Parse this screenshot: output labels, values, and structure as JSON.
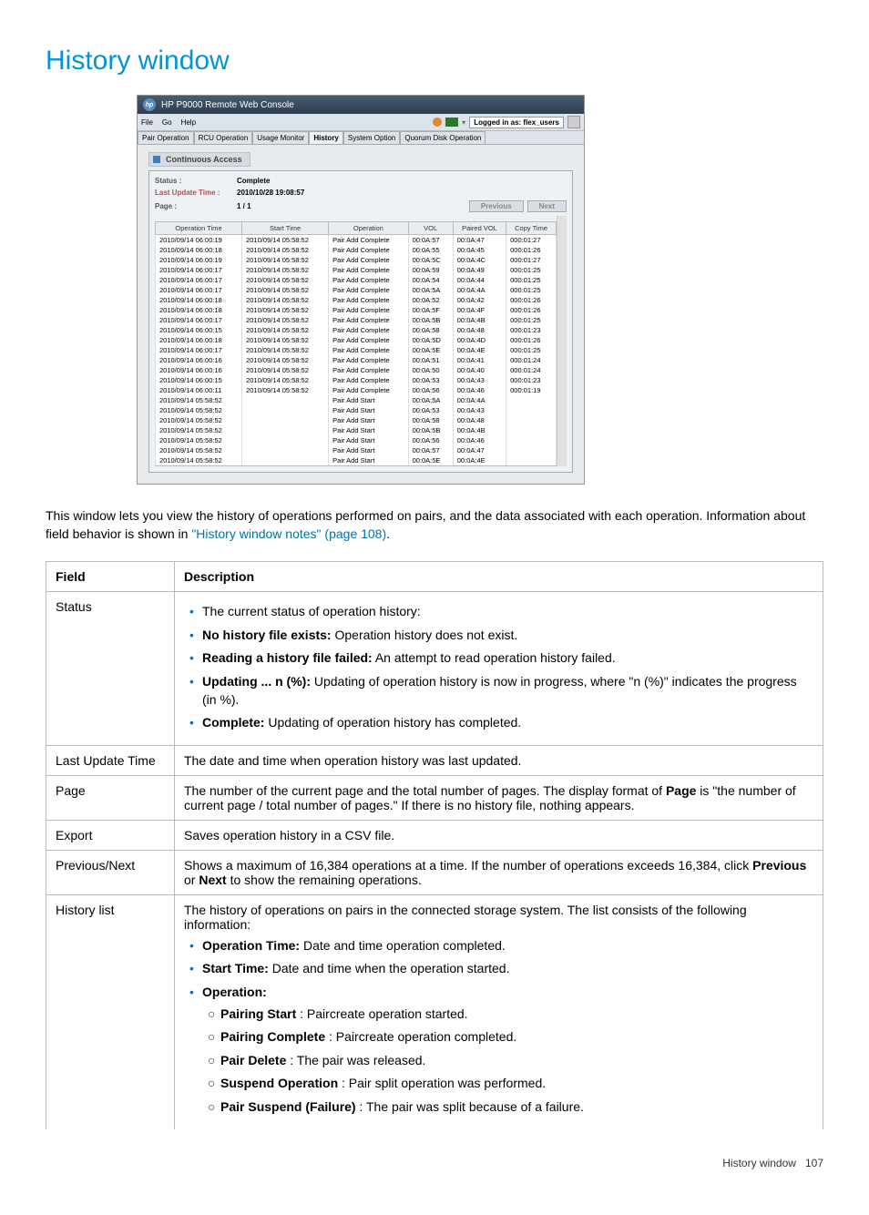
{
  "page_title": "History window",
  "footer": {
    "text": "History window",
    "page": "107"
  },
  "app": {
    "title": "HP P9000 Remote Web Console",
    "menus": [
      "File",
      "Go",
      "Help"
    ],
    "login_label": "Logged in as: flex_users",
    "tabs": [
      "Pair Operation",
      "RCU Operation",
      "Usage Monitor",
      "History",
      "System Option",
      "Quorum Disk Operation"
    ],
    "section": "Continuous Access",
    "status_label": "Status :",
    "status_value": "Complete",
    "update_label": "Last Update Time :",
    "update_value": "2010/10/28 19:08:57",
    "page_label": "Page :",
    "page_value": "1 / 1",
    "prev_btn": "Previous",
    "next_btn": "Next",
    "columns": [
      "Operation Time",
      "Start Time",
      "Operation",
      "VOL",
      "Paired VOL",
      "Copy Time"
    ],
    "rows": [
      [
        "2010/09/14 06:00:19",
        "2010/09/14 05:58:52",
        "Pair Add Complete",
        "00:0A:57",
        "00:0A:47",
        "000:01:27"
      ],
      [
        "2010/09/14 06:00:18",
        "2010/09/14 05:58:52",
        "Pair Add Complete",
        "00:0A:55",
        "00:0A:45",
        "000:01:26"
      ],
      [
        "2010/09/14 06:00:19",
        "2010/09/14 05:58:52",
        "Pair Add Complete",
        "00:0A:5C",
        "00:0A:4C",
        "000:01:27"
      ],
      [
        "2010/09/14 06:00:17",
        "2010/09/14 05:58:52",
        "Pair Add Complete",
        "00:0A:59",
        "00:0A:49",
        "000:01:25"
      ],
      [
        "2010/09/14 06:00:17",
        "2010/09/14 05:58:52",
        "Pair Add Complete",
        "00:0A:54",
        "00:0A:44",
        "000:01:25"
      ],
      [
        "2010/09/14 06:00:17",
        "2010/09/14 05:58:52",
        "Pair Add Complete",
        "00:0A:5A",
        "00:0A:4A",
        "000:01:25"
      ],
      [
        "2010/09/14 06:00:18",
        "2010/09/14 05:58:52",
        "Pair Add Complete",
        "00:0A:52",
        "00:0A:42",
        "000:01:26"
      ],
      [
        "2010/09/14 06:00:18",
        "2010/09/14 05:58:52",
        "Pair Add Complete",
        "00:0A:5F",
        "00:0A:4F",
        "000:01:26"
      ],
      [
        "2010/09/14 06:00:17",
        "2010/09/14 05:58:52",
        "Pair Add Complete",
        "00:0A:5B",
        "00:0A:4B",
        "000:01:25"
      ],
      [
        "2010/09/14 06:00:15",
        "2010/09/14 05:58:52",
        "Pair Add Complete",
        "00:0A:58",
        "00:0A:48",
        "000:01:23"
      ],
      [
        "2010/09/14 06:00:18",
        "2010/09/14 05:58:52",
        "Pair Add Complete",
        "00:0A:5D",
        "00:0A:4D",
        "000:01:26"
      ],
      [
        "2010/09/14 06:00:17",
        "2010/09/14 05:58:52",
        "Pair Add Complete",
        "00:0A:5E",
        "00:0A:4E",
        "000:01:25"
      ],
      [
        "2010/09/14 06:00:16",
        "2010/09/14 05:58:52",
        "Pair Add Complete",
        "00:0A:51",
        "00:0A:41",
        "000:01:24"
      ],
      [
        "2010/09/14 06:00:16",
        "2010/09/14 05:58:52",
        "Pair Add Complete",
        "00:0A:50",
        "00:0A:40",
        "000:01:24"
      ],
      [
        "2010/09/14 06:00:15",
        "2010/09/14 05:58:52",
        "Pair Add Complete",
        "00:0A:53",
        "00:0A:43",
        "000:01:23"
      ],
      [
        "2010/09/14 06:00:11",
        "2010/09/14 05:58:52",
        "Pair Add Complete",
        "00:0A:56",
        "00:0A:46",
        "000:01:19"
      ],
      [
        "2010/09/14 05:58:52",
        "",
        "Pair Add Start",
        "00:0A:5A",
        "00:0A:4A",
        ""
      ],
      [
        "2010/09/14 05:58:52",
        "",
        "Pair Add Start",
        "00:0A:53",
        "00:0A:43",
        ""
      ],
      [
        "2010/09/14 05:58:52",
        "",
        "Pair Add Start",
        "00:0A:58",
        "00:0A:48",
        ""
      ],
      [
        "2010/09/14 05:58:52",
        "",
        "Pair Add Start",
        "00:0A:5B",
        "00:0A:4B",
        ""
      ],
      [
        "2010/09/14 05:58:52",
        "",
        "Pair Add Start",
        "00:0A:56",
        "00:0A:46",
        ""
      ],
      [
        "2010/09/14 05:58:52",
        "",
        "Pair Add Start",
        "00:0A:57",
        "00:0A:47",
        ""
      ],
      [
        "2010/09/14 05:58:52",
        "",
        "Pair Add Start",
        "00:0A:5E",
        "00:0A:4E",
        ""
      ]
    ]
  },
  "intro": {
    "t1": "This window lets you view the history of operations performed on pairs, and the data associated with each operation. Information about field behavior is shown in ",
    "link": "\"History window notes\" (page 108)",
    "t2": "."
  },
  "table_headers": [
    "Field",
    "Description"
  ],
  "fields": {
    "status": {
      "name": "Status",
      "lead": "The current status of operation history:",
      "b1a": "No history file exists:",
      "b1b": " Operation history does not exist.",
      "b2a": "Reading a history file failed:",
      "b2b": " An attempt to read operation history failed.",
      "b3a": "Updating ... n (%):",
      "b3b": " Updating of operation history is now in progress, where \"n (%)\" indicates the progress (in %).",
      "b4a": "Complete:",
      "b4b": " Updating of operation history has completed."
    },
    "last_update": {
      "name": "Last Update Time",
      "desc": "The date and time when operation history was last updated."
    },
    "page": {
      "name": "Page",
      "d1": "The number of the current page and the total number of pages. The display format of ",
      "d2": "Page",
      "d3": " is \"the number of current page / total number of pages.\" If there is no history file, nothing appears."
    },
    "export": {
      "name": "Export",
      "desc": "Saves operation history in a CSV file."
    },
    "prevnext": {
      "name": "Previous/Next",
      "d1": "Shows a maximum of 16,384 operations at a time. If the number of operations exceeds 16,384, click ",
      "d2": "Previous",
      "d3": " or ",
      "d4": "Next",
      "d5": " to show the remaining operations."
    },
    "history": {
      "name": "History list",
      "lead": "The history of operations on pairs in the connected storage system. The list consists of the following information:",
      "b1a": "Operation Time:",
      "b1b": " Date and time operation completed.",
      "b2a": "Start Time:",
      "b2b": " Date and time when the operation started.",
      "b3a": "Operation:",
      "s1a": "Pairing Start",
      "s1b": " : Paircreate operation started.",
      "s2a": "Pairing Complete",
      "s2b": " : Paircreate operation completed.",
      "s3a": "Pair Delete",
      "s3b": " : The pair was released.",
      "s4a": "Suspend Operation",
      "s4b": " : Pair split operation was performed.",
      "s5a": "Pair Suspend (Failure)",
      "s5b": " : The pair was split because of a failure."
    }
  }
}
